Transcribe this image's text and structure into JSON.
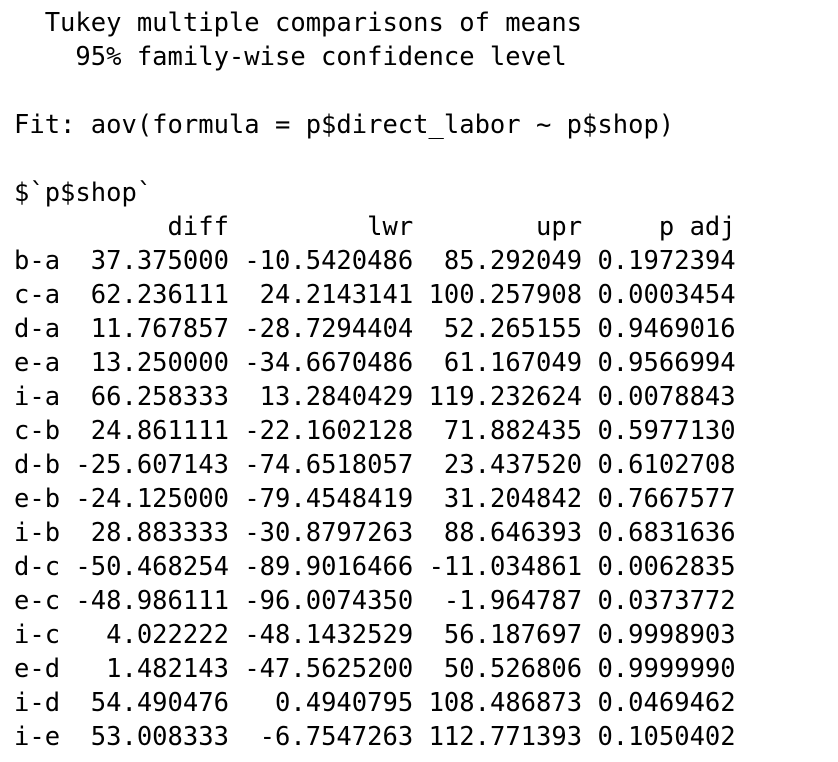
{
  "header": {
    "title_line": "  Tukey multiple comparisons of means",
    "conf_line": "    95% family-wise confidence level"
  },
  "fit_line": "Fit: aov(formula = p$direct_labor ~ p$shop)",
  "term_line": "$`p$shop`",
  "table": {
    "columns": [
      "diff",
      "lwr",
      "upr",
      "p adj"
    ],
    "rows": [
      {
        "label": "b-a",
        "diff": "37.375000",
        "lwr": "-10.5420486",
        "upr": "85.292049",
        "p_adj": "0.1972394"
      },
      {
        "label": "c-a",
        "diff": "62.236111",
        "lwr": "24.2143141",
        "upr": "100.257908",
        "p_adj": "0.0003454"
      },
      {
        "label": "d-a",
        "diff": "11.767857",
        "lwr": "-28.7294404",
        "upr": "52.265155",
        "p_adj": "0.9469016"
      },
      {
        "label": "e-a",
        "diff": "13.250000",
        "lwr": "-34.6670486",
        "upr": "61.167049",
        "p_adj": "0.9566994"
      },
      {
        "label": "i-a",
        "diff": "66.258333",
        "lwr": "13.2840429",
        "upr": "119.232624",
        "p_adj": "0.0078843"
      },
      {
        "label": "c-b",
        "diff": "24.861111",
        "lwr": "-22.1602128",
        "upr": "71.882435",
        "p_adj": "0.5977130"
      },
      {
        "label": "d-b",
        "diff": "-25.607143",
        "lwr": "-74.6518057",
        "upr": "23.437520",
        "p_adj": "0.6102708"
      },
      {
        "label": "e-b",
        "diff": "-24.125000",
        "lwr": "-79.4548419",
        "upr": "31.204842",
        "p_adj": "0.7667577"
      },
      {
        "label": "i-b",
        "diff": "28.883333",
        "lwr": "-30.8797263",
        "upr": "88.646393",
        "p_adj": "0.6831636"
      },
      {
        "label": "d-c",
        "diff": "-50.468254",
        "lwr": "-89.9016466",
        "upr": "-11.034861",
        "p_adj": "0.0062835"
      },
      {
        "label": "e-c",
        "diff": "-48.986111",
        "lwr": "-96.0074350",
        "upr": "-1.964787",
        "p_adj": "0.0373772"
      },
      {
        "label": "i-c",
        "diff": "4.022222",
        "lwr": "-48.1432529",
        "upr": "56.187697",
        "p_adj": "0.9998903"
      },
      {
        "label": "e-d",
        "diff": "1.482143",
        "lwr": "-47.5625200",
        "upr": "50.526806",
        "p_adj": "0.9999990"
      },
      {
        "label": "i-d",
        "diff": "54.490476",
        "lwr": "0.4940795",
        "upr": "108.486873",
        "p_adj": "0.0469462"
      },
      {
        "label": "i-e",
        "diff": "53.008333",
        "lwr": "-6.7547263",
        "upr": "112.771393",
        "p_adj": "0.1050402"
      }
    ]
  }
}
